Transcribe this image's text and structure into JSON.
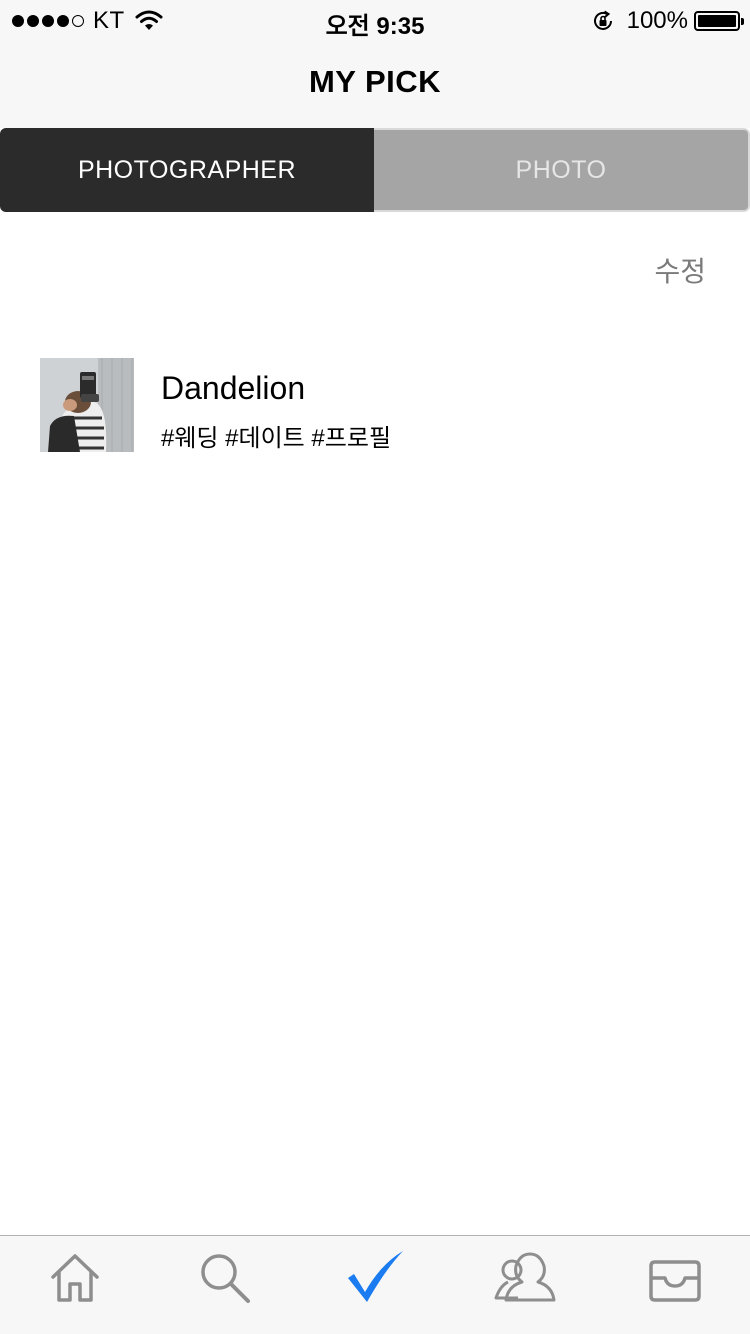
{
  "status_bar": {
    "carrier": "KT",
    "time": "오전 9:35",
    "battery": "100%",
    "battery_level": 1.0,
    "signal_bars": 4,
    "signal_total": 5
  },
  "nav": {
    "title": "MY PICK"
  },
  "segments": {
    "photographer": "PHOTOGRAPHER",
    "photo": "PHOTO",
    "selected": "photographer"
  },
  "edit_label": "수정",
  "list": [
    {
      "name": "Dandelion",
      "tags": "#웨딩 #데이트 #프로필"
    }
  ],
  "tab_bar": {
    "items": [
      "home-icon",
      "search-icon",
      "checkmark-icon",
      "people-icon",
      "inbox-icon"
    ],
    "active_index": 2
  },
  "colors": {
    "accent": "#1a7cf0",
    "icon_inactive": "#8e8e8e",
    "segment_active": "#2b2b2b",
    "segment_inactive": "#a5a5a5"
  }
}
